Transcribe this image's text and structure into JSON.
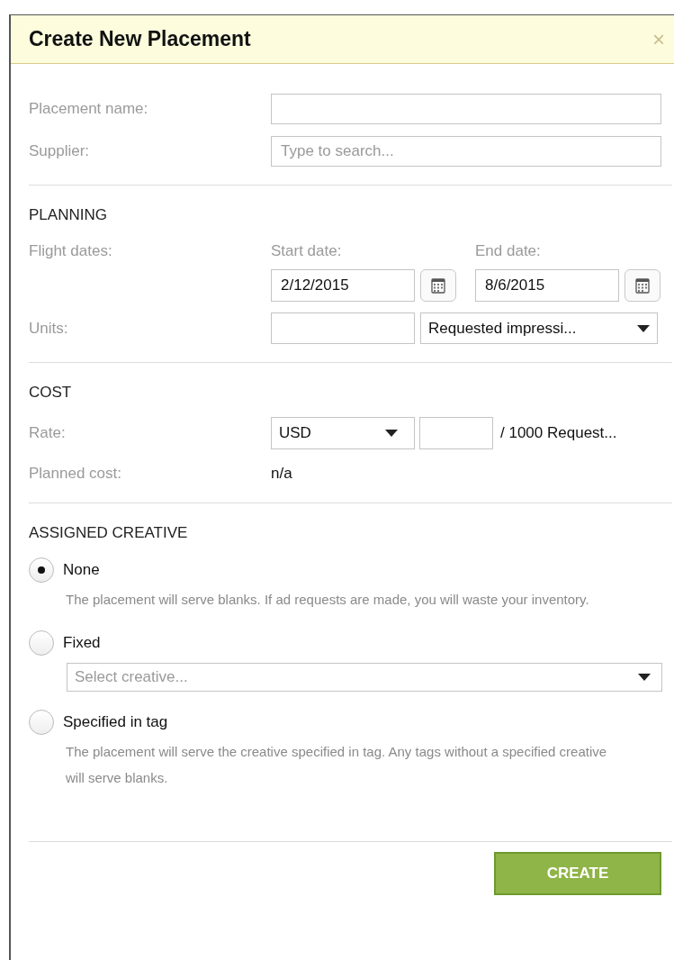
{
  "dialog": {
    "title": "Create New Placement",
    "close": "×"
  },
  "general": [
    {
      "label": "Placement name:"
    },
    {
      "label": "Supplier:",
      "placeholder": "Type to search..."
    }
  ],
  "planning": {
    "heading": "PLANNING",
    "flight_label": "Flight dates:",
    "start_label": "Start date:",
    "start_value": "2/12/2015",
    "end_label": "End date:",
    "end_value": "8/6/2015",
    "units_label": "Units:",
    "units_select": "Requested impressi..."
  },
  "cost": {
    "heading": "COST",
    "rate_label": "Rate:",
    "currency": "USD",
    "rate_suffix": "/ 1000 Request...",
    "planned_label": "Planned cost:",
    "planned_value": "n/a"
  },
  "creative": {
    "heading": "ASSIGNED CREATIVE",
    "options": [
      {
        "label": "None",
        "selected": true,
        "kind": "description",
        "text": "The placement will serve blanks. If ad requests are made, you will waste your inventory."
      },
      {
        "label": "Fixed",
        "selected": false,
        "kind": "select",
        "text": "Select creative..."
      },
      {
        "label": "Specified in tag",
        "selected": false,
        "kind": "description",
        "text": "The placement will serve the creative specified in tag. Any tags without a specified creative will serve blanks."
      }
    ]
  },
  "buttons": [
    "CREATE"
  ]
}
